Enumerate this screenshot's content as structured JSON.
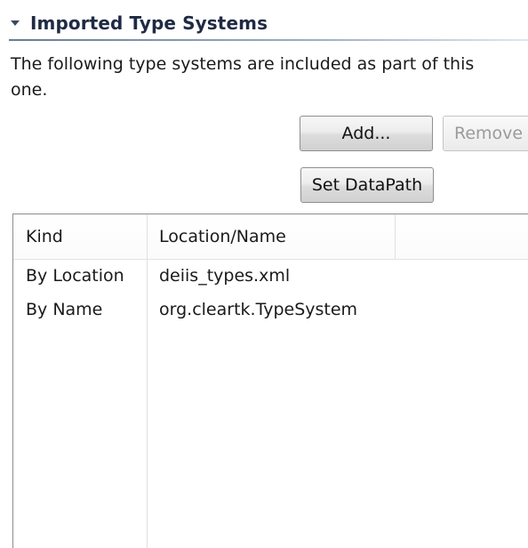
{
  "section": {
    "title": "Imported Type Systems",
    "description": "The following type systems are included as part of this one."
  },
  "buttons": {
    "add_label": "Add...",
    "remove_label": "Remove",
    "set_datapath_label": "Set DataPath"
  },
  "table": {
    "columns": [
      "Kind",
      "Location/Name"
    ],
    "rows": [
      {
        "kind": "By Location",
        "location": "deiis_types.xml"
      },
      {
        "kind": "By Name",
        "location": "org.cleartk.TypeSystem"
      }
    ]
  },
  "colors": {
    "title": "#1f2a44",
    "twisty": "#3b4a66",
    "disabled_text": "#9b9b9b"
  },
  "icons": {
    "twisty": "expanded-triangle"
  }
}
